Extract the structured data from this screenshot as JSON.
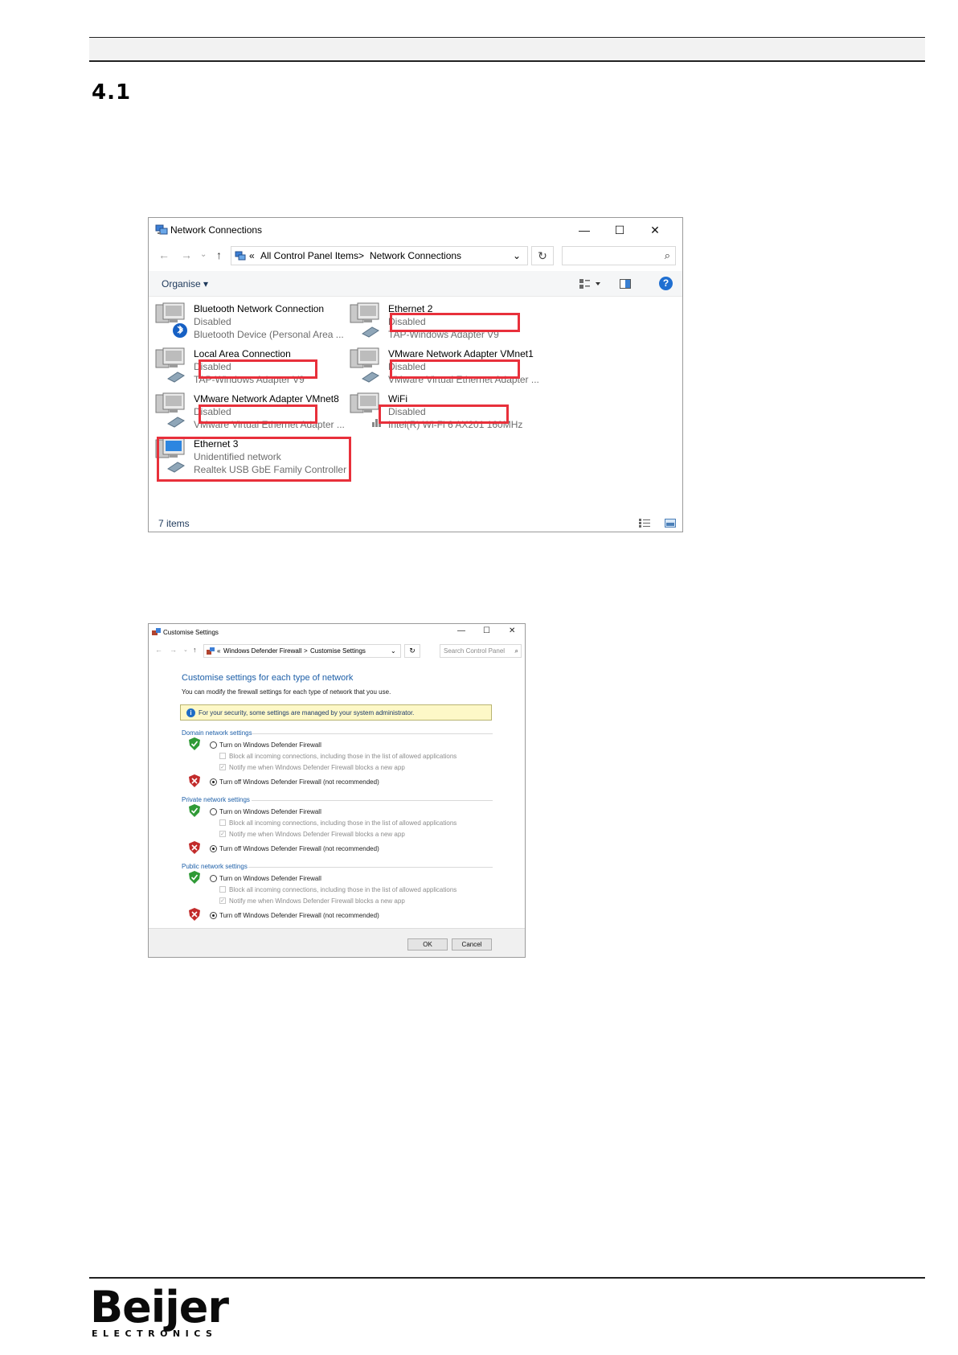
{
  "section": {
    "number": "4.1"
  },
  "network_connections": {
    "title": "Network Connections",
    "window_controls": {
      "minimize": "—",
      "maximize": "☐",
      "close": "✕"
    },
    "nav": {
      "back": "←",
      "forward": "→",
      "recent": "⌄",
      "up": "↑"
    },
    "address": {
      "prefix": "«",
      "crumb1": "All Control Panel Items",
      "separator": ">",
      "crumb2": "Network Connections",
      "dropdown": "⌄"
    },
    "refresh": "↻",
    "search_icon": "search-icon",
    "organise": "Organise ▾",
    "status_bar": "7 items",
    "items": [
      {
        "name": "Bluetooth Network Connection",
        "status": "Disabled",
        "device": "Bluetooth Device (Personal Area ..."
      },
      {
        "name": "Ethernet 2",
        "status": "Disabled",
        "device": "TAP-Windows Adapter V9"
      },
      {
        "name": "Local Area Connection",
        "status": "Disabled",
        "device": "TAP-Windows Adapter V9"
      },
      {
        "name": "VMware Network Adapter VMnet1",
        "status": "Disabled",
        "device": "VMware Virtual Ethernet Adapter ..."
      },
      {
        "name": "VMware Network Adapter VMnet8",
        "status": "Disabled",
        "device": "VMware Virtual Ethernet Adapter ..."
      },
      {
        "name": "WiFi",
        "status": "Disabled",
        "device": "Intel(R) Wi-Fi 6 AX201 160MHz"
      },
      {
        "name": "Ethernet 3",
        "status": "Unidentified network",
        "device": "Realtek USB GbE Family Controller"
      }
    ],
    "highlight_color": "#e8303b"
  },
  "customise_settings": {
    "title": "Customise Settings",
    "window_controls": {
      "minimize": "—",
      "maximize": "☐",
      "close": "✕"
    },
    "address": {
      "prefix": "«",
      "crumb1": "Windows Defender Firewall",
      "separator": ">",
      "crumb2": "Customise Settings",
      "dropdown": "⌄"
    },
    "refresh": "↻",
    "search_placeholder": "Search Control Panel",
    "heading": "Customise settings for each type of network",
    "subtext": "You can modify the firewall settings for each type of network that you use.",
    "info_banner": "For your security, some settings are managed by your system administrator.",
    "sections": [
      {
        "title": "Domain network settings",
        "turn_on": "Turn on Windows Defender Firewall",
        "block_all": "Block all incoming connections, including those in the list of allowed applications",
        "notify": "Notify me when Windows Defender Firewall blocks a new app",
        "turn_off": "Turn off Windows Defender Firewall (not recommended)",
        "selected": "off"
      },
      {
        "title": "Private network settings",
        "turn_on": "Turn on Windows Defender Firewall",
        "block_all": "Block all incoming connections, including those in the list of allowed applications",
        "notify": "Notify me when Windows Defender Firewall blocks a new app",
        "turn_off": "Turn off Windows Defender Firewall (not recommended)",
        "selected": "off"
      },
      {
        "title": "Public network settings",
        "turn_on": "Turn on Windows Defender Firewall",
        "block_all": "Block all incoming connections, including those in the list of allowed applications",
        "notify": "Notify me when Windows Defender Firewall blocks a new app",
        "turn_off": "Turn off Windows Defender Firewall (not recommended)",
        "selected": "off"
      }
    ],
    "ok_label": "OK",
    "cancel_label": "Cancel"
  },
  "footer": {
    "logo_text": "Beijer",
    "logo_sub": "ELECTRONICS"
  }
}
